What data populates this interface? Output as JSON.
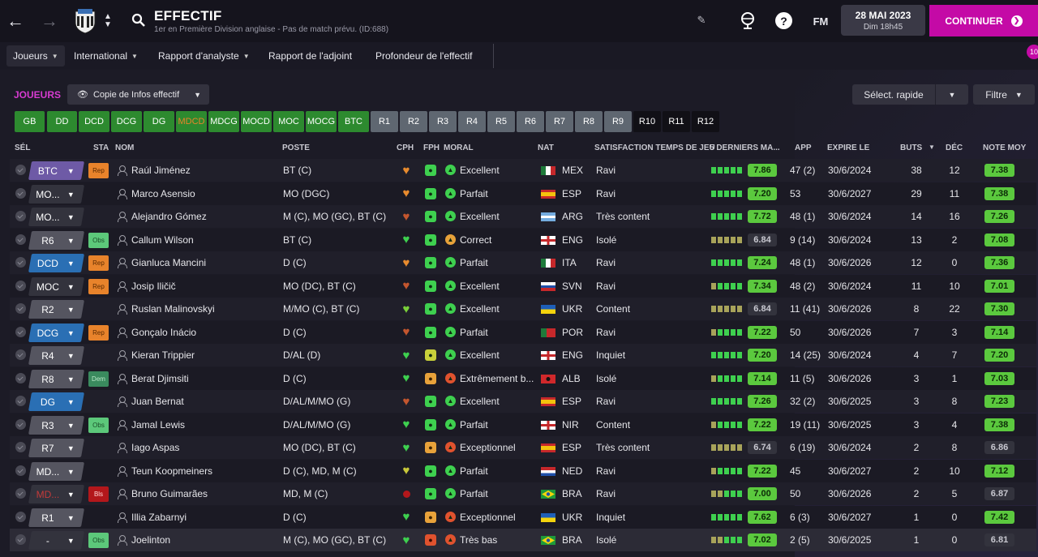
{
  "header": {
    "title": "EFFECTIF",
    "subtitle": "1er en Première Division anglaise - Pas de match prévu. (ID:688)",
    "fm_label": "FM",
    "date": "28 MAI 2023",
    "time": "Dim 18h45",
    "continue_label": "CONTINUER",
    "notif_count": "10"
  },
  "menu": [
    "Joueurs",
    "International",
    "Rapport d'analyste",
    "Rapport de l'adjoint",
    "Profondeur de l'effectif"
  ],
  "section": {
    "title": "JOUEURS",
    "view": "Copie de Infos effectif",
    "quick_select": "Sélect. rapide",
    "filter": "Filtre"
  },
  "positions": [
    "GB",
    "DD",
    "DCD",
    "DCG",
    "DG",
    "MDCD",
    "MDCG",
    "MOCD",
    "MOC",
    "MOCG",
    "BTC",
    "R1",
    "R2",
    "R3",
    "R4",
    "R5",
    "R6",
    "R7",
    "R8",
    "R9",
    "R10",
    "R11",
    "R12"
  ],
  "columns": {
    "sel": "SÉL",
    "sta": "STA",
    "nom": "NOM",
    "poste": "POSTE",
    "cph": "CPH",
    "fph": "FPH",
    "moral": "MORAL",
    "nat": "NAT",
    "sat": "SATISFACTION TEMPS DE JEU",
    "last5": "5 DERNIERS MA...",
    "app": "APP",
    "expire": "EXPIRE LE",
    "buts": "BUTS",
    "dec": "DÉC",
    "note": "NOTE MOY"
  },
  "players": [
    {
      "sel": "BTC",
      "sta": "Rep",
      "name": "Raúl Jiménez",
      "poste": "BT (C)",
      "moral": "Excellent",
      "nat": "MEX",
      "sat": "Ravi",
      "rating": "7.86",
      "app": "47 (2)",
      "expire": "30/6/2024",
      "buts": "38",
      "dec": "12",
      "note": "7.38"
    },
    {
      "sel": "MO...",
      "sta": "",
      "name": "Marco Asensio",
      "poste": "MO (DGC)",
      "moral": "Parfait",
      "nat": "ESP",
      "sat": "Ravi",
      "rating": "7.20",
      "app": "53",
      "expire": "30/6/2027",
      "buts": "29",
      "dec": "11",
      "note": "7.38"
    },
    {
      "sel": "MO...",
      "sta": "",
      "name": "Alejandro Gómez",
      "poste": "M (C), MO (GC), BT (C)",
      "moral": "Excellent",
      "nat": "ARG",
      "sat": "Très content",
      "rating": "7.72",
      "app": "48 (1)",
      "expire": "30/6/2024",
      "buts": "14",
      "dec": "16",
      "note": "7.26"
    },
    {
      "sel": "R6",
      "sta": "Obs",
      "name": "Callum Wilson",
      "poste": "BT (C)",
      "moral": "Correct",
      "nat": "ENG",
      "sat": "Isolé",
      "rating": "6.84",
      "app": "9 (14)",
      "expire": "30/6/2024",
      "buts": "13",
      "dec": "2",
      "note": "7.08"
    },
    {
      "sel": "DCD",
      "sta": "Rep",
      "name": "Gianluca Mancini",
      "poste": "D (C)",
      "moral": "Parfait",
      "nat": "ITA",
      "sat": "Ravi",
      "rating": "7.24",
      "app": "48 (1)",
      "expire": "30/6/2026",
      "buts": "12",
      "dec": "0",
      "note": "7.36"
    },
    {
      "sel": "MOC",
      "sta": "Rep",
      "name": "Josip Iličič",
      "poste": "MO (DC), BT (C)",
      "moral": "Excellent",
      "nat": "SVN",
      "sat": "Ravi",
      "rating": "7.34",
      "app": "48 (2)",
      "expire": "30/6/2024",
      "buts": "11",
      "dec": "10",
      "note": "7.01"
    },
    {
      "sel": "R2",
      "sta": "",
      "name": "Ruslan Malinovskyi",
      "poste": "M/MO (C), BT (C)",
      "moral": "Excellent",
      "nat": "UKR",
      "sat": "Content",
      "rating": "6.84",
      "app": "11 (41)",
      "expire": "30/6/2026",
      "buts": "8",
      "dec": "22",
      "note": "7.30"
    },
    {
      "sel": "DCG",
      "sta": "Rep",
      "name": "Gonçalo Inácio",
      "poste": "D (C)",
      "moral": "Parfait",
      "nat": "POR",
      "sat": "Ravi",
      "rating": "7.22",
      "app": "50",
      "expire": "30/6/2026",
      "buts": "7",
      "dec": "3",
      "note": "7.14"
    },
    {
      "sel": "R4",
      "sta": "",
      "name": "Kieran Trippier",
      "poste": "D/AL (D)",
      "moral": "Excellent",
      "nat": "ENG",
      "sat": "Inquiet",
      "rating": "7.20",
      "app": "14 (25)",
      "expire": "30/6/2024",
      "buts": "4",
      "dec": "7",
      "note": "7.20"
    },
    {
      "sel": "R8",
      "sta": "Dem",
      "name": "Berat Djimsiti",
      "poste": "D (C)",
      "moral": "Extrêmement b...",
      "nat": "ALB",
      "sat": "Isolé",
      "rating": "7.14",
      "app": "11 (5)",
      "expire": "30/6/2026",
      "buts": "3",
      "dec": "1",
      "note": "7.03"
    },
    {
      "sel": "DG",
      "sta": "",
      "name": "Juan Bernat",
      "poste": "D/AL/M/MO (G)",
      "moral": "Excellent",
      "nat": "ESP",
      "sat": "Ravi",
      "rating": "7.26",
      "app": "32 (2)",
      "expire": "30/6/2025",
      "buts": "3",
      "dec": "8",
      "note": "7.23"
    },
    {
      "sel": "R3",
      "sta": "Obs",
      "name": "Jamal Lewis",
      "poste": "D/AL/M/MO (G)",
      "moral": "Parfait",
      "nat": "NIR",
      "sat": "Content",
      "rating": "7.22",
      "app": "19 (11)",
      "expire": "30/6/2025",
      "buts": "3",
      "dec": "4",
      "note": "7.38"
    },
    {
      "sel": "R7",
      "sta": "",
      "name": "Iago Aspas",
      "poste": "MO (DC), BT (C)",
      "moral": "Exceptionnel",
      "nat": "ESP",
      "sat": "Très content",
      "rating": "6.74",
      "app": "6 (19)",
      "expire": "30/6/2024",
      "buts": "2",
      "dec": "8",
      "note": "6.86"
    },
    {
      "sel": "MD...",
      "sta": "",
      "name": "Teun Koopmeiners",
      "poste": "D (C), MD, M (C)",
      "moral": "Parfait",
      "nat": "NED",
      "sat": "Ravi",
      "rating": "7.22",
      "app": "45",
      "expire": "30/6/2027",
      "buts": "2",
      "dec": "10",
      "note": "7.12"
    },
    {
      "sel": "MD...",
      "sta": "Bls",
      "name": "Bruno Guimarães",
      "poste": "MD, M (C)",
      "moral": "Parfait",
      "nat": "BRA",
      "sat": "Ravi",
      "rating": "7.00",
      "app": "50",
      "expire": "30/6/2026",
      "buts": "2",
      "dec": "5",
      "note": "6.87"
    },
    {
      "sel": "R1",
      "sta": "",
      "name": "Illia Zabarnyi",
      "poste": "D (C)",
      "moral": "Exceptionnel",
      "nat": "UKR",
      "sat": "Inquiet",
      "rating": "7.62",
      "app": "6 (3)",
      "expire": "30/6/2027",
      "buts": "1",
      "dec": "0",
      "note": "7.42"
    },
    {
      "sel": "-",
      "sta": "Obs",
      "name": "Joelinton",
      "poste": "M (C), MO (GC), BT (C)",
      "moral": "Très bas",
      "nat": "BRA",
      "sat": "Isolé",
      "rating": "7.02",
      "app": "2 (5)",
      "expire": "30/6/2025",
      "buts": "1",
      "dec": "0",
      "note": "6.81"
    }
  ]
}
